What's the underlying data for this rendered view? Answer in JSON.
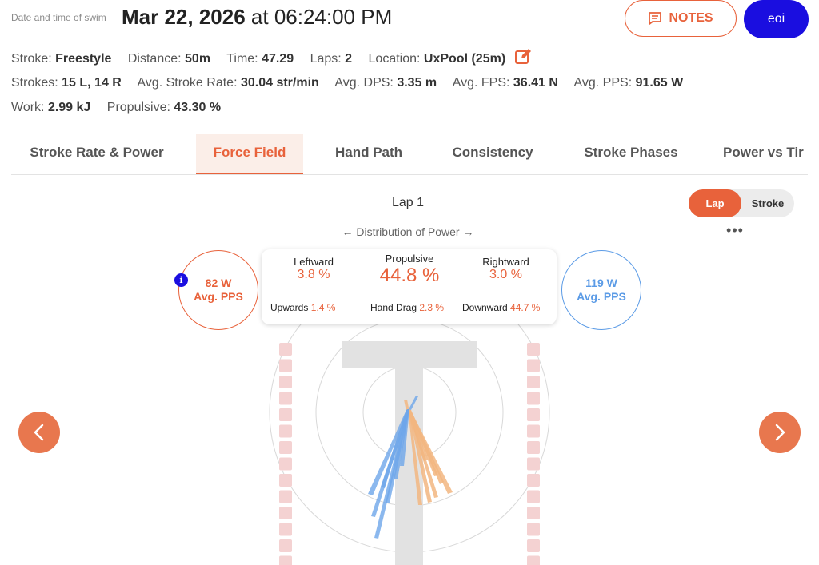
{
  "header": {
    "date_label": "Date and time of swim",
    "date": "Mar 22, 2026",
    "at": " at ",
    "time": "06:24:00 PM",
    "notes_label": "NOTES",
    "user_label": "eoi"
  },
  "stats_row1": {
    "stroke_label": "Stroke:",
    "stroke_value": "Freestyle",
    "distance_label": "Distance:",
    "distance_value": "50m",
    "time_label": "Time:",
    "time_value": "47.29",
    "laps_label": "Laps:",
    "laps_value": "2",
    "location_label": "Location:",
    "location_value": "UxPool (25m)"
  },
  "stats_row2": {
    "strokes_label": "Strokes:",
    "strokes_value": "15 L, 14 R",
    "rate_label": "Avg. Stroke Rate:",
    "rate_value": "30.04 str/min",
    "dps_label": "Avg. DPS:",
    "dps_value": "3.35 m",
    "fps_label": "Avg. FPS:",
    "fps_value": "36.41 N",
    "pps_label": "Avg. PPS:",
    "pps_value": "91.65 W"
  },
  "stats_row3": {
    "work_label": "Work:",
    "work_value": "2.99 kJ",
    "propulsive_label": "Propulsive:",
    "propulsive_value": "43.30 %"
  },
  "tabs": [
    {
      "label": "Stroke Rate & Power",
      "active": false
    },
    {
      "label": "Force Field",
      "active": true
    },
    {
      "label": "Hand Path",
      "active": false
    },
    {
      "label": "Consistency",
      "active": false
    },
    {
      "label": "Stroke Phases",
      "active": false
    },
    {
      "label": "Power vs Tir",
      "active": false
    }
  ],
  "panel": {
    "lap_title": "Lap 1",
    "toggle": {
      "lap": "Lap",
      "stroke": "Stroke",
      "selected": "Lap"
    },
    "more": "•••",
    "distribution": "← Distribution of Power →"
  },
  "left_circle": {
    "value": "82 W",
    "label": "Avg. PPS",
    "info": "i"
  },
  "right_circle": {
    "value": "119 W",
    "label": "Avg. PPS"
  },
  "distribution": {
    "leftward_label": "Leftward",
    "leftward_value": "3.8 %",
    "propulsive_label": "Propulsive",
    "propulsive_value": "44.8 %",
    "rightward_label": "Rightward",
    "rightward_value": "3.0 %",
    "upwards_label": "Upwards",
    "upwards_value": "1.4 %",
    "handdrag_label": "Hand Drag",
    "handdrag_value": "2.3 %",
    "downward_label": "Downward",
    "downward_value": "44.7 %"
  },
  "colors": {
    "accent": "#e8623b",
    "left_hand": "#5b9be6",
    "right_hand": "#f0a86a",
    "user": "#1a0ee0",
    "lane": "#f4d2d2"
  },
  "icons": {
    "notes": "note-icon",
    "edit": "edit-icon",
    "prev": "chevron-left-icon",
    "next": "chevron-right-icon",
    "info": "info-icon"
  }
}
